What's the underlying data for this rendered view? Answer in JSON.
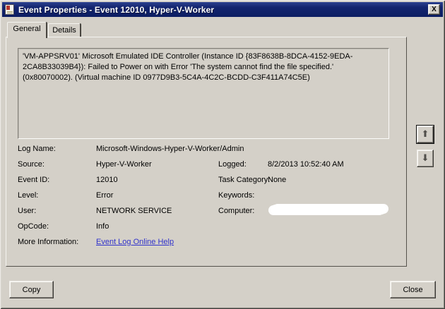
{
  "window": {
    "title": "Event Properties - Event 12010, Hyper-V-Worker",
    "close_glyph": "X"
  },
  "tabs": {
    "general": "General",
    "details": "Details"
  },
  "message": "'VM-APPSRV01' Microsoft Emulated IDE Controller (Instance ID {83F8638B-8DCA-4152-9EDA-2CA8B33039B4}): Failed to Power on with Error 'The system cannot find the file specified.' (0x80070002). (Virtual machine ID 0977D9B3-5C4A-4C2C-BCDD-C3F411A74C5E)",
  "fields": {
    "rows": [
      {
        "label": "Log Name:",
        "value": "Microsoft-Windows-Hyper-V-Worker/Admin",
        "right_label": "",
        "right_value": ""
      },
      {
        "label": "Source:",
        "value": "Hyper-V-Worker",
        "right_label": "Logged:",
        "right_value": "8/2/2013 10:52:40 AM"
      },
      {
        "label": "Event ID:",
        "value": "12010",
        "right_label": "Task Category:",
        "right_value": "None"
      },
      {
        "label": "Level:",
        "value": "Error",
        "right_label": "Keywords:",
        "right_value": ""
      },
      {
        "label": "User:",
        "value": "NETWORK SERVICE",
        "right_label": "Computer:",
        "right_value": ""
      },
      {
        "label": "OpCode:",
        "value": "Info"
      },
      {
        "label": "More Information:",
        "link": "Event Log Online Help"
      }
    ],
    "computer_value_redacted": true
  },
  "nav": {
    "up_glyph": "⬆",
    "down_glyph": "⬇"
  },
  "buttons": {
    "copy": "Copy",
    "close": "Close"
  },
  "colors": {
    "titlebar": "#13256f",
    "dialog_bg": "#d4d0c8",
    "link": "#3133cb",
    "title_text": "#ffffff"
  }
}
